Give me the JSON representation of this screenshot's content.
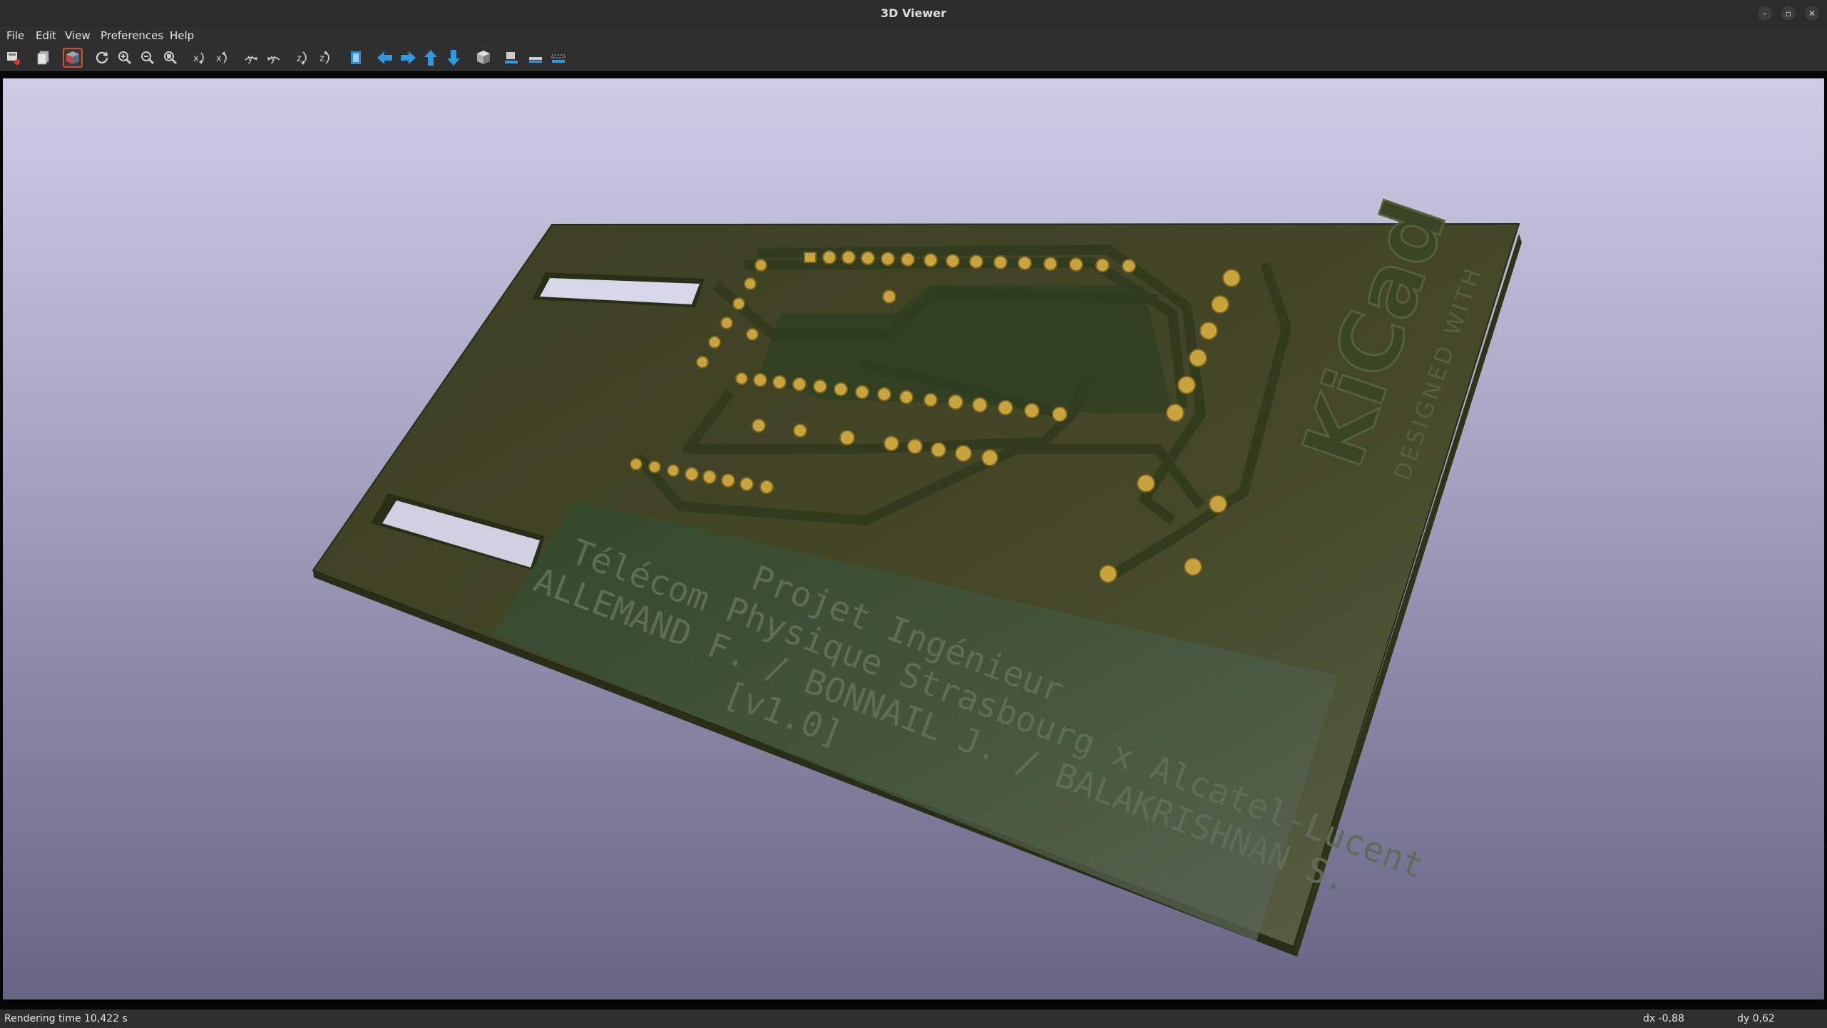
{
  "window": {
    "title": "3D Viewer",
    "minimize_glyph": "–",
    "maximize_glyph": "▫",
    "close_glyph": "✕"
  },
  "menu": [
    "File",
    "Edit",
    "View",
    "Preferences",
    "Help"
  ],
  "toolbar_icons": [
    "render-options-icon",
    "copy-image-icon",
    "raytracing-toggle-icon",
    "reload-icon",
    "zoom-in-icon",
    "zoom-out-icon",
    "zoom-fit-icon",
    "rotate-x-cw-icon",
    "rotate-x-ccw-icon",
    "rotate-y-cw-icon",
    "rotate-y-ccw-icon",
    "rotate-z-cw-icon",
    "rotate-z-ccw-icon",
    "flip-board-icon",
    "pan-left-icon",
    "pan-right-icon",
    "pan-up-icon",
    "pan-down-icon",
    "ortho-cube-icon",
    "view-front-icon",
    "view-top-icon",
    "view-side-icon"
  ],
  "board": {
    "silkscreen_lines": [
      "Projet Ingénieur",
      "Télécom Physique Strasbourg x Alcatel-Lucent",
      "ALLEMAND F. / BONNAIL J. / BALAKRISHNAN S.",
      "[v1.0]"
    ],
    "logo_text": "KiCad",
    "logo_subtext": "DESIGNED WITH",
    "colors": {
      "board": "#3f4226",
      "pad": "#c9a33c",
      "silk_area": "#4a5a4a"
    }
  },
  "status": {
    "render_time": "Rendering time 10,422 s",
    "dx": "dx -0,88",
    "dy": "dy 0,62"
  }
}
